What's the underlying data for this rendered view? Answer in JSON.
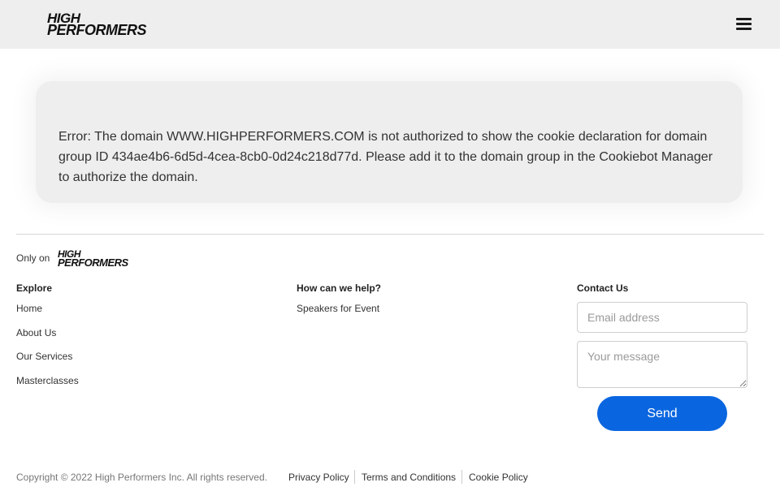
{
  "header": {
    "logo_line1": "HIGH",
    "logo_line2": "PERFORMERS",
    "menu_icon": "hamburger-menu-icon"
  },
  "error": {
    "message": "Error: The domain WWW.HIGHPERFORMERS.COM is not authorized to show the cookie declaration for domain group ID 434ae4b6-6d5d-4cea-8cb0-0d24c218d77d. Please add it to the domain group in the Cookiebot Manager to authorize the domain."
  },
  "footer": {
    "only_on": "Only on",
    "logo_line1": "HIGH",
    "logo_line2": "PERFORMERS",
    "explore": {
      "title": "Explore",
      "links": [
        "Home",
        "About Us",
        "Our Services",
        "Masterclasses"
      ]
    },
    "help": {
      "title": "How can we help?",
      "links": [
        "Speakers for Event"
      ]
    },
    "contact": {
      "title": "Contact Us",
      "email_placeholder": "Email address",
      "message_placeholder": "Your message",
      "send_label": "Send"
    },
    "copyright": "Copyright © 2022 High Performers Inc. All rights reserved.",
    "legal": [
      "Privacy Policy",
      "Terms and Conditions",
      "Cookie Policy"
    ]
  },
  "colors": {
    "header_bg": "#eeeeee",
    "card_bg": "#eeeeee",
    "accent": "#0a66e0"
  }
}
